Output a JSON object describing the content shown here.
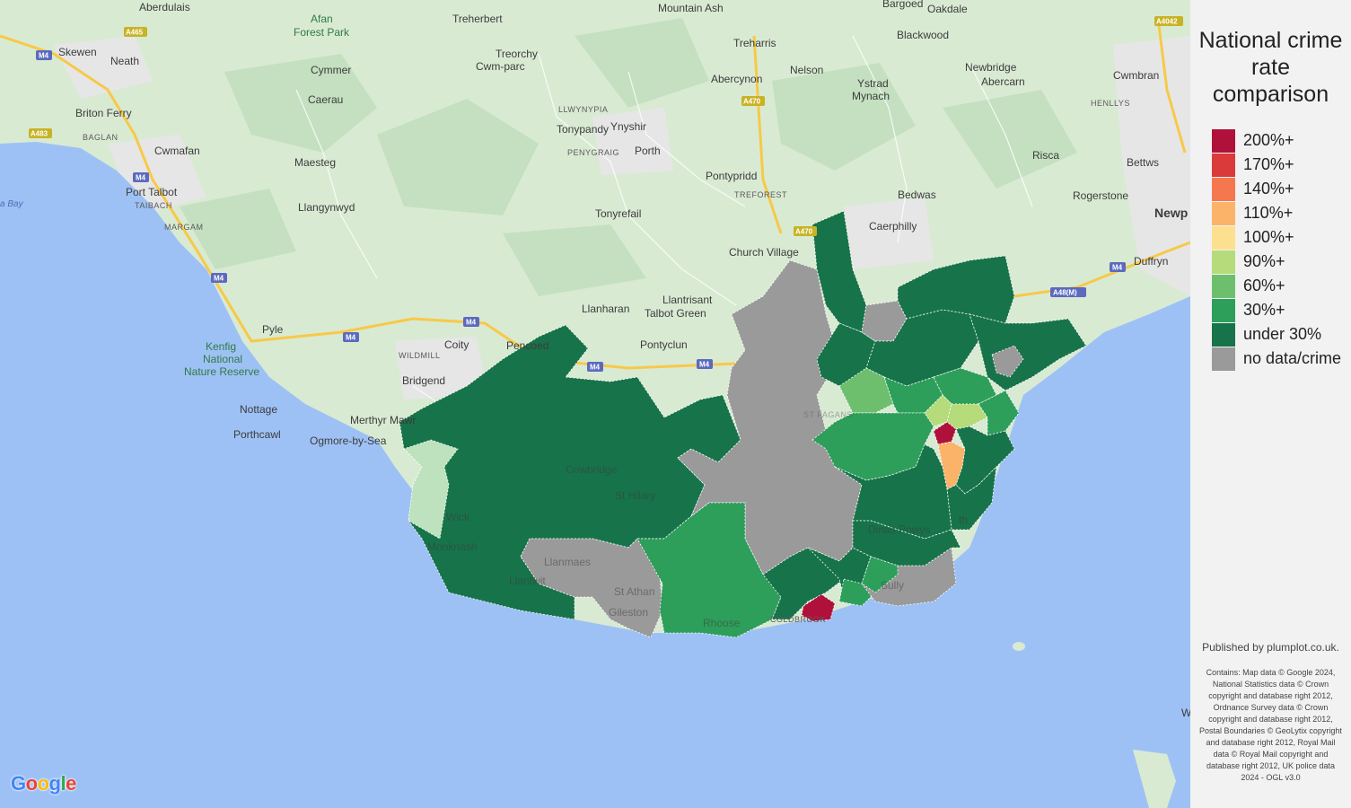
{
  "legend": {
    "title": "National crime rate comparison",
    "items": [
      {
        "label": "200%+",
        "color": "#b0113a"
      },
      {
        "label": "170%+",
        "color": "#db3a3a"
      },
      {
        "label": "140%+",
        "color": "#f4774e"
      },
      {
        "label": "110%+",
        "color": "#fbb36a"
      },
      {
        "label": "100%+",
        "color": "#fde08f"
      },
      {
        "label": "90%+",
        "color": "#b5db7a"
      },
      {
        "label": "60%+",
        "color": "#6dbf6e"
      },
      {
        "label": "30%+",
        "color": "#2e9e5b"
      },
      {
        "label": "under 30%",
        "color": "#17734a"
      },
      {
        "label": "no data/crime",
        "color": "#9a9a9a"
      }
    ]
  },
  "published": "Published by plumplot.co.uk.",
  "attribution": "Contains: Map data © Google 2024, National Statistics data © Crown copyright and database right 2012, Ordnance Survey data © Crown copyright and database right 2012, Postal Boundaries © GeoLytix copyright and database right 2012, Royal Mail data © Royal Mail copyright and database right 2012, UK police data 2024 - OGL v3.0",
  "google": [
    "G",
    "o",
    "o",
    "g",
    "l",
    "e"
  ],
  "google_colors": [
    "#4285f4",
    "#ea4335",
    "#fbbc05",
    "#4285f4",
    "#34a853",
    "#ea4335"
  ],
  "places": [
    {
      "name": "Aberdulais"
    },
    {
      "name": "Skewen"
    },
    {
      "name": "Neath"
    },
    {
      "name": "Briton Ferry"
    },
    {
      "name": "BAGLAN"
    },
    {
      "name": "Cwmafan"
    },
    {
      "name": "Port Talbot"
    },
    {
      "name": "TAIBACH"
    },
    {
      "name": "MARGAM"
    },
    {
      "name": "Afan"
    },
    {
      "name": "Forest Park"
    },
    {
      "name": "Cymmer"
    },
    {
      "name": "Caerau"
    },
    {
      "name": "Maesteg"
    },
    {
      "name": "Llangynwyd"
    },
    {
      "name": "Pyle"
    },
    {
      "name": "Kenfig"
    },
    {
      "name": "National"
    },
    {
      "name": "Nature Reserve"
    },
    {
      "name": "Nottage"
    },
    {
      "name": "Porthcawl"
    },
    {
      "name": "Treherbert"
    },
    {
      "name": "Treorchy"
    },
    {
      "name": "Cwm-parc"
    },
    {
      "name": "LLWYNYPIA"
    },
    {
      "name": "Tonypandy"
    },
    {
      "name": "PENYGRAIG"
    },
    {
      "name": "Ynyshir"
    },
    {
      "name": "Porth"
    },
    {
      "name": "Tonyrefail"
    },
    {
      "name": "Mountain Ash"
    },
    {
      "name": "Treharris"
    },
    {
      "name": "Abercynon"
    },
    {
      "name": "Nelson"
    },
    {
      "name": "Pontypridd"
    },
    {
      "name": "TREFOREST"
    },
    {
      "name": "Church Village"
    },
    {
      "name": "Llanharan"
    },
    {
      "name": "Llantrisant"
    },
    {
      "name": "Talbot Green"
    },
    {
      "name": "Pontyclun"
    },
    {
      "name": "Coity"
    },
    {
      "name": "WILDMILL"
    },
    {
      "name": "Bridgend"
    },
    {
      "name": "Pencoed"
    },
    {
      "name": "Merthyr Mawr"
    },
    {
      "name": "Ogmore-by-Sea"
    },
    {
      "name": "Bargoed"
    },
    {
      "name": "Oakdale"
    },
    {
      "name": "Blackwood"
    },
    {
      "name": "Newbridge"
    },
    {
      "name": "Ystrad"
    },
    {
      "name": "Mynach"
    },
    {
      "name": "Abercarn"
    },
    {
      "name": "Cwmbran"
    },
    {
      "name": "HENLLYS"
    },
    {
      "name": "Risca"
    },
    {
      "name": "Bettws"
    },
    {
      "name": "Bedwas"
    },
    {
      "name": "Caerphilly"
    },
    {
      "name": "Rogerstone"
    },
    {
      "name": "Newp"
    },
    {
      "name": "Duffryn"
    },
    {
      "name": "Cowbridge"
    },
    {
      "name": "St Hilary"
    },
    {
      "name": "Wick"
    },
    {
      "name": "Monknash"
    },
    {
      "name": "Llantwit"
    },
    {
      "name": "Llanmaes"
    },
    {
      "name": "St Athan"
    },
    {
      "name": "Gileston"
    },
    {
      "name": "Rhoose"
    },
    {
      "name": "ST FAGANS"
    },
    {
      "name": "Dinas Powys"
    },
    {
      "name": "Sully"
    },
    {
      "name": "COLDBROOK"
    },
    {
      "name": "th"
    },
    {
      "name": "a Bay"
    },
    {
      "name": "W"
    }
  ],
  "roads": [
    {
      "label": "M4"
    },
    {
      "label": "A465"
    },
    {
      "label": "A483"
    },
    {
      "label": "A470"
    },
    {
      "label": "A4042"
    },
    {
      "label": "A48(M)"
    }
  ]
}
